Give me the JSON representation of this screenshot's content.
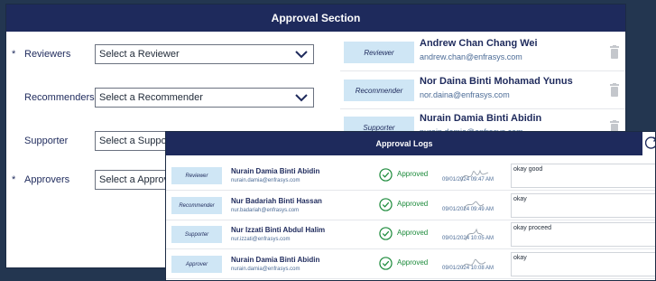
{
  "approval": {
    "title": "Approval Section",
    "fields": [
      {
        "label": "Reviewers",
        "required": "*",
        "placeholder": "Select a Reviewer"
      },
      {
        "label": "Recommenders",
        "required": "",
        "placeholder": "Select a Recommender"
      },
      {
        "label": "Supporter",
        "required": "",
        "placeholder": "Select a Supporter"
      },
      {
        "label": "Approvers",
        "required": "*",
        "placeholder": "Select a Approver"
      }
    ],
    "assigned": [
      {
        "role": "Reviewer",
        "name": "Andrew Chan Chang Wei",
        "email": "andrew.chan@enfrasys.com"
      },
      {
        "role": "Recommender",
        "name": "Nor Daina Binti Mohamad Yunus",
        "email": "nor.daina@enfrasys.com"
      },
      {
        "role": "Supporter",
        "name": "Nurain Damia Binti Abidin",
        "email": "nurain.damia@enfrasys.com"
      }
    ]
  },
  "logs": {
    "title": "Approval Logs",
    "rows": [
      {
        "role": "Reviewer",
        "name": "Nurain Damia Binti Abidin",
        "email": "nurain.damia@enfrasys.com",
        "status": "Approved",
        "date": "09/01/2024 09:47 AM",
        "comment": "okay good"
      },
      {
        "role": "Recommender",
        "name": "Nur Badariah Binti Hassan",
        "email": "nur.badariah@enfrasys.com",
        "status": "Approved",
        "date": "09/01/2024 09:49 AM",
        "comment": "okay"
      },
      {
        "role": "Supporter",
        "name": "Nur Izzati Binti Abdul Halim",
        "email": "nur.izzati@enfrasys.com",
        "status": "Approved",
        "date": "09/01/2024 10:05 AM",
        "comment": "okay proceed"
      },
      {
        "role": "Approver",
        "name": "Nurain Damia Binti Abidin",
        "email": "nurain.damia@enfrasys.com",
        "status": "Approved",
        "date": "09/01/2024 10:08 AM",
        "comment": "okay"
      }
    ]
  },
  "colors": {
    "header": "#1e2a5c",
    "pill": "#cfe6f5",
    "approved": "#1b8a3a"
  },
  "icons": [
    "chevron-down-icon",
    "trash-icon",
    "check-circle-icon",
    "refresh-icon",
    "signature-icon"
  ]
}
